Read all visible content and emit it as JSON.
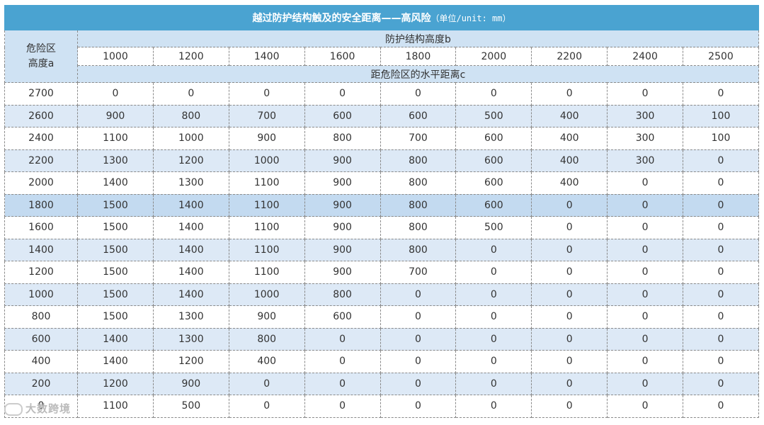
{
  "table": {
    "title": "越过防护结构触及的安全距离——高风险",
    "unit": "（单位/unit: mm）",
    "row_header": "危险区高度a",
    "col_group_header": "防护结构高度b",
    "value_header": "距危险区的水平距离c",
    "columns": [
      "1000",
      "1200",
      "1400",
      "1600",
      "1800",
      "2000",
      "2200",
      "2400",
      "2500"
    ],
    "rows": [
      {
        "a": "2700",
        "c": [
          "0",
          "0",
          "0",
          "0",
          "0",
          "0",
          "0",
          "0",
          "0"
        ]
      },
      {
        "a": "2600",
        "c": [
          "900",
          "800",
          "700",
          "600",
          "600",
          "500",
          "400",
          "300",
          "100"
        ]
      },
      {
        "a": "2400",
        "c": [
          "1100",
          "1000",
          "900",
          "800",
          "700",
          "600",
          "400",
          "300",
          "100"
        ]
      },
      {
        "a": "2200",
        "c": [
          "1300",
          "1200",
          "1000",
          "900",
          "800",
          "600",
          "400",
          "300",
          "0"
        ]
      },
      {
        "a": "2000",
        "c": [
          "1400",
          "1300",
          "1100",
          "900",
          "800",
          "600",
          "400",
          "0",
          "0"
        ]
      },
      {
        "a": "1800",
        "c": [
          "1500",
          "1400",
          "1100",
          "900",
          "800",
          "600",
          "0",
          "0",
          "0"
        ]
      },
      {
        "a": "1600",
        "c": [
          "1500",
          "1400",
          "1100",
          "900",
          "800",
          "500",
          "0",
          "0",
          "0"
        ]
      },
      {
        "a": "1400",
        "c": [
          "1500",
          "1400",
          "1100",
          "900",
          "800",
          "0",
          "0",
          "0",
          "0"
        ]
      },
      {
        "a": "1200",
        "c": [
          "1500",
          "1400",
          "1100",
          "900",
          "700",
          "0",
          "0",
          "0",
          "0"
        ]
      },
      {
        "a": "1000",
        "c": [
          "1500",
          "1400",
          "1000",
          "800",
          "0",
          "0",
          "0",
          "0",
          "0"
        ]
      },
      {
        "a": "800",
        "c": [
          "1500",
          "1300",
          "900",
          "600",
          "0",
          "0",
          "0",
          "0",
          "0"
        ]
      },
      {
        "a": "600",
        "c": [
          "1400",
          "1300",
          "800",
          "0",
          "0",
          "0",
          "0",
          "0",
          "0"
        ]
      },
      {
        "a": "400",
        "c": [
          "1400",
          "1200",
          "400",
          "0",
          "0",
          "0",
          "0",
          "0",
          "0"
        ]
      },
      {
        "a": "200",
        "c": [
          "1200",
          "900",
          "0",
          "0",
          "0",
          "0",
          "0",
          "0",
          "0"
        ]
      },
      {
        "a": "0",
        "c": [
          "1100",
          "500",
          "0",
          "0",
          "0",
          "0",
          "0",
          "0",
          "0"
        ]
      }
    ]
  },
  "watermark": "大数跨境",
  "colors": {
    "title_bg": "#4aa3d1",
    "header_bg": "#cfe2f3",
    "alt_row": "#dde9f6",
    "highlight_row": "#c3daf0"
  }
}
